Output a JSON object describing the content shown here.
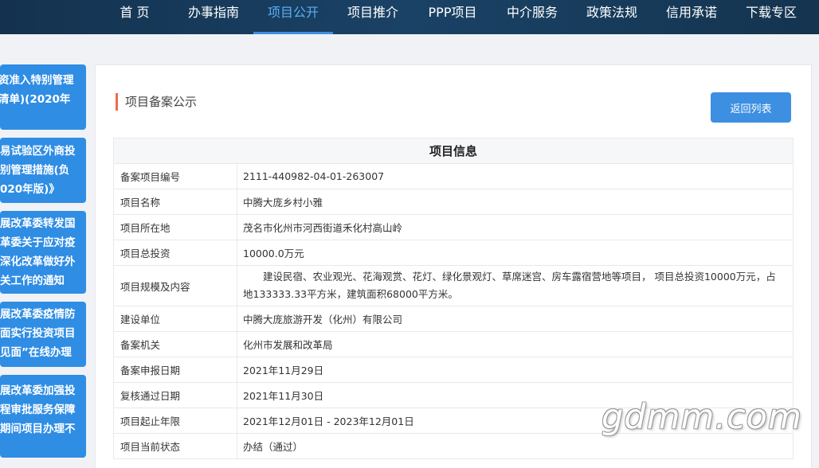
{
  "nav": {
    "items": [
      {
        "label": "首 页"
      },
      {
        "label": "办事指南"
      },
      {
        "label": "项目公开"
      },
      {
        "label": "项目推介"
      },
      {
        "label": "PPP项目"
      },
      {
        "label": "中介服务"
      },
      {
        "label": "政策法规"
      },
      {
        "label": "信用承诺"
      },
      {
        "label": "下载专区"
      }
    ],
    "active_index": 2
  },
  "sidebar": {
    "cards": [
      {
        "lines": [
          "资准入特别管理",
          "清单)(2020年"
        ]
      },
      {
        "lines": [
          "易试验区外商投",
          "别管理措施(负",
          "020年版)》"
        ]
      },
      {
        "lines": [
          "展改革委转发国",
          "革委关于应对疫",
          "深化改革做好外",
          "关工作的通知"
        ]
      },
      {
        "lines": [
          "展改革委疫情防",
          "面实行投资项目",
          "见面”在线办理"
        ]
      },
      {
        "lines": [
          "展改革委加强投",
          "程审批服务保障",
          "期间项目办理不"
        ]
      }
    ]
  },
  "panel": {
    "title": "项目备案公示",
    "back_button": "返回列表"
  },
  "table": {
    "header": "项目信息",
    "rows": [
      {
        "label": "备案项目编号",
        "value": "2111-440982-04-01-263007"
      },
      {
        "label": "项目名称",
        "value": "中腾大庞乡村小雅"
      },
      {
        "label": "项目所在地",
        "value": "茂名市化州市河西街道禾化村高山岭"
      },
      {
        "label": "项目总投资",
        "value": "10000.0万元"
      },
      {
        "label": "项目规模及内容",
        "value_line1": "建设民宿、农业观光、花海观赏、花灯、绿化景观灯、草席迷宫、房车露宿营地等项目， 项目总投资10000万元，占",
        "value_line2": "地133333.33平方米，建筑面积68000平方米。"
      },
      {
        "label": "建设单位",
        "value": "中腾大庞旅游开发（化州）有限公司"
      },
      {
        "label": "备案机关",
        "value": "化州市发展和改革局"
      },
      {
        "label": "备案申报日期",
        "value": "2021年11月29日"
      },
      {
        "label": "复核通过日期",
        "value": "2021年11月30日"
      },
      {
        "label": "项目起止年限",
        "value": "2021年12月01日 - 2023年12月01日"
      },
      {
        "label": "项目当前状态",
        "value": "办结（通过）"
      }
    ]
  },
  "watermark": "gdmm.com",
  "colors": {
    "nav_bg": "#1a3f61",
    "nav_active": "#5aaef5",
    "sidebar_card": "#2f8de4",
    "title_accent": "#ef6b4a",
    "button": "#3d8fe1"
  }
}
